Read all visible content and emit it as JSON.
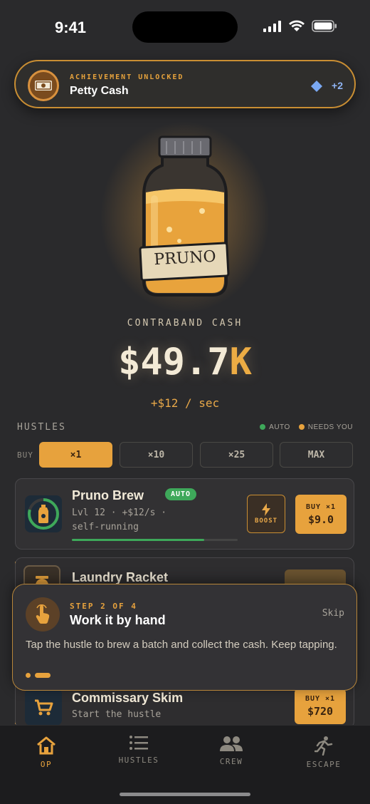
{
  "status": {
    "time": "9:41"
  },
  "achievement": {
    "subtitle": "ACHIEVEMENT UNLOCKED",
    "title": "Petty Cash",
    "reward": "+2"
  },
  "jar": {
    "label": "PRUNO"
  },
  "cash": {
    "label": "CONTRABAND CASH",
    "amount_main": "$49.7",
    "amount_suffix": "K",
    "rate": "+$12 / sec"
  },
  "hustles": {
    "heading": "HUSTLES",
    "legend": [
      {
        "label": "AUTO",
        "color": "#3ea85a"
      },
      {
        "label": "NEEDS YOU",
        "color": "#e7a23d"
      }
    ],
    "buy_label": "BUY",
    "buy_options": [
      "×1",
      "×10",
      "×25",
      "MAX"
    ],
    "selected_option": "×1",
    "items": [
      {
        "name": "Pruno Brew",
        "badge": "AUTO",
        "line1": "Lvl 12 · +$12/s ·",
        "line2": "self-running",
        "progress": 0.8,
        "boost": "BOOST",
        "buy_top": "BUY ×1",
        "buy_price": "$9.0"
      },
      {
        "name": "Laundry Racket"
      },
      {
        "name": "Commissary Skim",
        "line1": "Start the hustle",
        "buy_top": "BUY ×1",
        "buy_price": "$720"
      }
    ]
  },
  "coach": {
    "step": "STEP 2 OF 4",
    "title": "Work it by hand",
    "skip": "Skip",
    "body": "Tap the hustle to brew a batch and collect the cash. Keep tapping."
  },
  "tabs": [
    {
      "label": "OP",
      "icon": "home-icon",
      "active": true
    },
    {
      "label": "HUSTLES",
      "icon": "list-icon",
      "active": false
    },
    {
      "label": "CREW",
      "icon": "people-icon",
      "active": false
    },
    {
      "label": "ESCAPE",
      "icon": "running-icon",
      "active": false
    }
  ],
  "colors": {
    "accent": "#e7a23d",
    "auto_green": "#3ea85a",
    "background": "#2a2a2c"
  }
}
